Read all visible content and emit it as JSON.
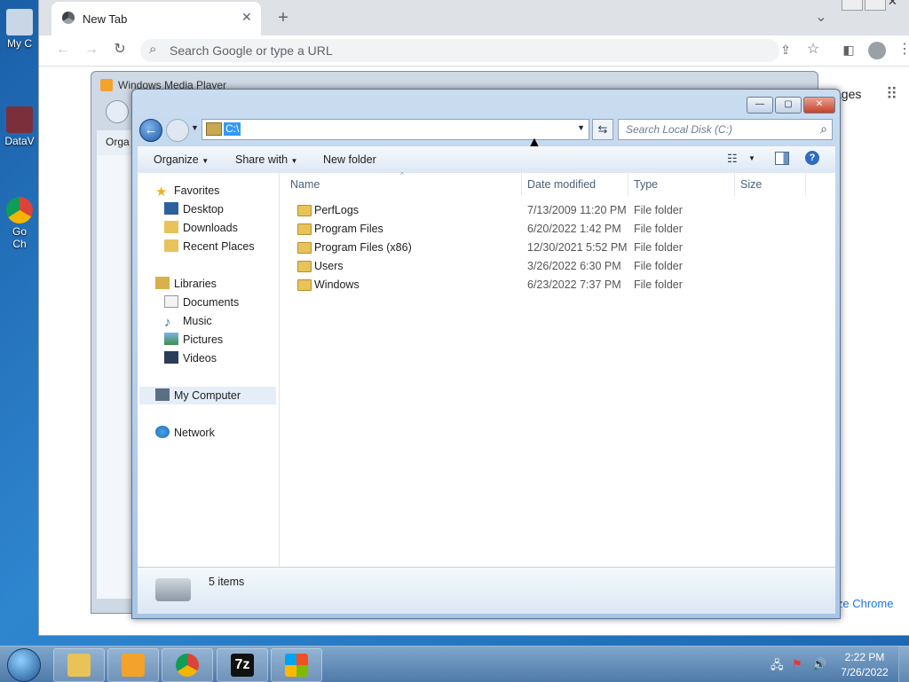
{
  "desktop": {
    "icons": [
      {
        "label": "My C"
      },
      {
        "label": "DataV"
      },
      {
        "label": "Go"
      },
      {
        "label": "Ch"
      }
    ]
  },
  "chrome": {
    "tab_title": "New Tab",
    "omnibox_placeholder": "Search Google or type a URL",
    "right_link": "ages",
    "customize_link": "ize Chrome"
  },
  "wmp": {
    "title": "Windows Media Player",
    "organize_partial": "Orga"
  },
  "explorer": {
    "address_value": "C:\\",
    "search_placeholder": "Search Local Disk (C:)",
    "toolbar": {
      "organize": "Organize",
      "share_with": "Share with",
      "new_folder": "New folder"
    },
    "nav": {
      "favorites": "Favorites",
      "favorites_items": [
        "Desktop",
        "Downloads",
        "Recent Places"
      ],
      "libraries": "Libraries",
      "libraries_items": [
        "Documents",
        "Music",
        "Pictures",
        "Videos"
      ],
      "my_computer": "My Computer",
      "network": "Network"
    },
    "columns": {
      "name": "Name",
      "date": "Date modified",
      "type": "Type",
      "size": "Size"
    },
    "rows": [
      {
        "name": "PerfLogs",
        "date": "7/13/2009 11:20 PM",
        "type": "File folder"
      },
      {
        "name": "Program Files",
        "date": "6/20/2022 1:42 PM",
        "type": "File folder"
      },
      {
        "name": "Program Files (x86)",
        "date": "12/30/2021 5:52 PM",
        "type": "File folder"
      },
      {
        "name": "Users",
        "date": "3/26/2022 6:30 PM",
        "type": "File folder"
      },
      {
        "name": "Windows",
        "date": "6/23/2022 7:37 PM",
        "type": "File folder"
      }
    ],
    "status": "5 items"
  },
  "taskbar": {
    "time": "2:22 PM",
    "date": "7/26/2022",
    "seven_zip": "7z"
  },
  "colors": {
    "accent": "#1e5aa0",
    "folder": "#e8c35a",
    "selection": "#3399ff"
  }
}
